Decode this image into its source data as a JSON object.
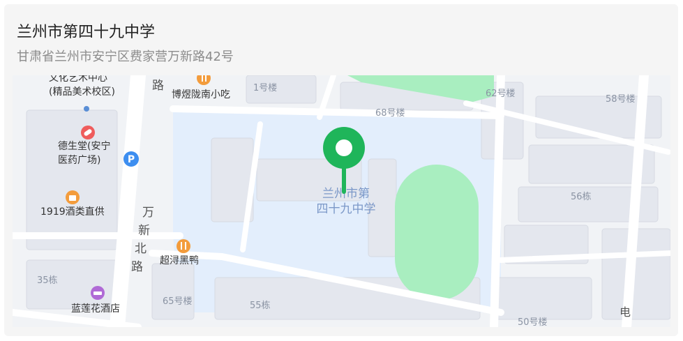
{
  "place": {
    "name": "兰州市第四十九中学",
    "address": "甘肃省兰州市安宁区费家营万新路42号"
  },
  "map": {
    "colors": {
      "campus": "#e3eefc",
      "field": "#a9eec0",
      "marker": "#1fb55a",
      "roads": "#ffffff",
      "blocks": "#e4e7ee"
    },
    "labels": {
      "school_line1": "兰州市第",
      "school_line2": "四十九中学",
      "arts_center_top": "文化艺术中心",
      "arts_center": "(精品美术校区)",
      "desheng_1": "德生堂(安宁",
      "desheng_2": "医药广场)",
      "liquor": "1919酒类直供",
      "snack": "博煜陇南小吃",
      "duck": "超浔黑鸭",
      "hotel": "蓝莲花酒店",
      "road_wanxin": "万新北路",
      "road_top": "路",
      "road_right": "电杆",
      "b1": "1号楼",
      "b68": "68号楼",
      "b62": "62号楼",
      "b58": "58号楼",
      "b56": "56栋",
      "b35": "35栋",
      "b65": "65号楼",
      "b55": "55栋",
      "b50": "50号楼"
    },
    "icons": {
      "parking": "P",
      "food_1": "fork-knife-icon",
      "food_2": "fork-knife-icon",
      "shop": "shopping-bag-icon",
      "pharmacy": "pill-icon",
      "hotel": "bed-icon",
      "dot": "poi-dot-icon",
      "marker": "location-pin-icon"
    }
  }
}
